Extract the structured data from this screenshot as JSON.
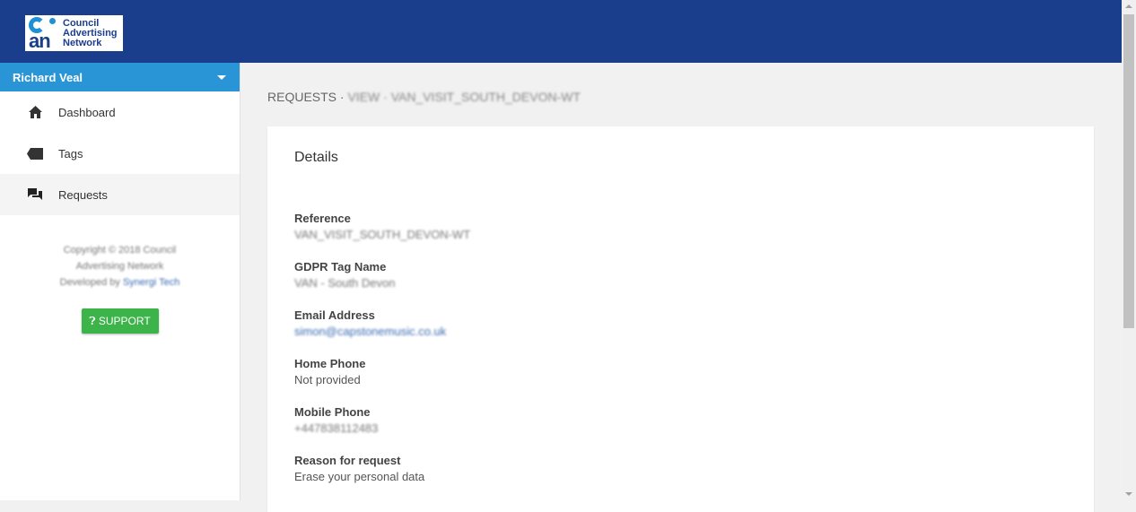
{
  "header": {
    "logo": {
      "line1": "Council",
      "line2": "Advertising",
      "line3": "Network",
      "mark": "an"
    }
  },
  "sidebar": {
    "user_name": "Richard Veal",
    "items": [
      {
        "label": "Dashboard",
        "icon": "home-icon"
      },
      {
        "label": "Tags",
        "icon": "tag-icon"
      },
      {
        "label": "Requests",
        "icon": "chat-icon"
      }
    ],
    "copyright": "Copyright © 2018 Council",
    "copyright2": "Advertising Network",
    "developed_by": "Developed by",
    "developer": "Synergi Tech",
    "support_label": "SUPPORT"
  },
  "main": {
    "breadcrumb_prefix": "REQUESTS · ",
    "breadcrumb_rest": "VIEW · VAN_VISIT_SOUTH_DEVON-WT",
    "card_title": "Details",
    "fields": [
      {
        "label": "Reference",
        "value": "VAN_VISIT_SOUTH_DEVON-WT"
      },
      {
        "label": "GDPR Tag Name",
        "value": "VAN - South Devon"
      },
      {
        "label": "Email Address",
        "value": "simon@capstonemusic.co.uk"
      },
      {
        "label": "Home Phone",
        "value": "Not provided"
      },
      {
        "label": "Mobile Phone",
        "value": "+447838112483"
      },
      {
        "label": "Reason for request",
        "value": "Erase your personal data"
      }
    ]
  },
  "colors": {
    "header_bg": "#1a3e8c",
    "user_bar_bg": "#2a95d6",
    "support_bg": "#3cb44a"
  }
}
